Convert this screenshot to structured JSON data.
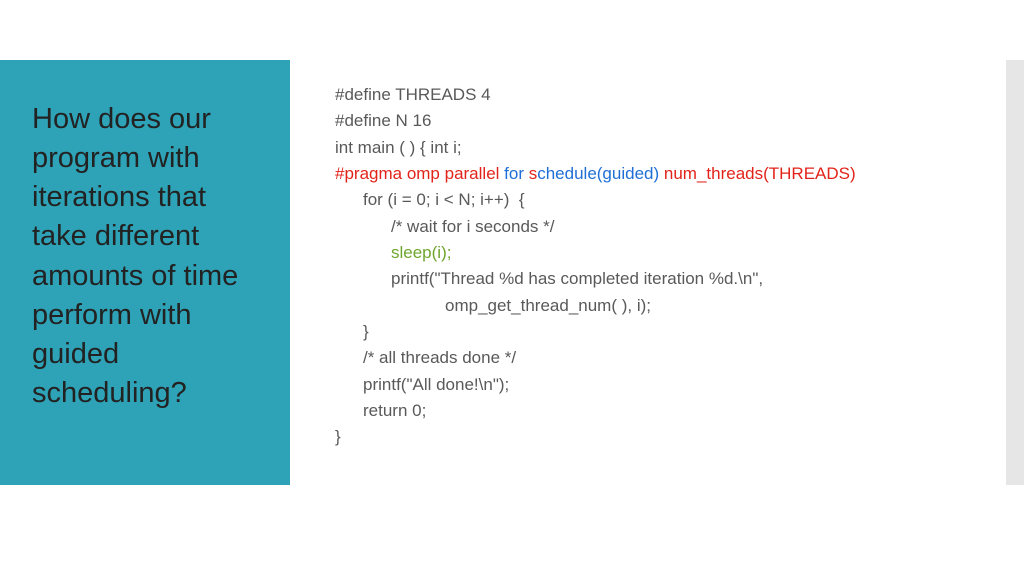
{
  "sidebar": {
    "title": "How does our program with iterations that take different amounts of time perform with guided scheduling?"
  },
  "code": {
    "l0": "#define THREADS 4",
    "l1": "#define N 16",
    "l2": "int main ( ) { int i;",
    "pragma_red1": "#pragma omp parallel ",
    "pragma_blue1": "for ",
    "pragma_red2": "s",
    "pragma_blue2": "chedule(guided) ",
    "pragma_red3": "num_threads(THREADS)",
    "l4": "for (i = 0; i < N; i++)  {",
    "l5": "/* wait for i seconds */",
    "l6": "sleep(i);",
    "l7": "printf(\"Thread %d has completed iteration %d.\\n\",",
    "l7b": "omp_get_thread_num( ), i);",
    "l8": "}",
    "l9": "/* all threads done */",
    "l10": "printf(\"All done!\\n\");",
    "l11": "return 0;",
    "l12": "}"
  }
}
